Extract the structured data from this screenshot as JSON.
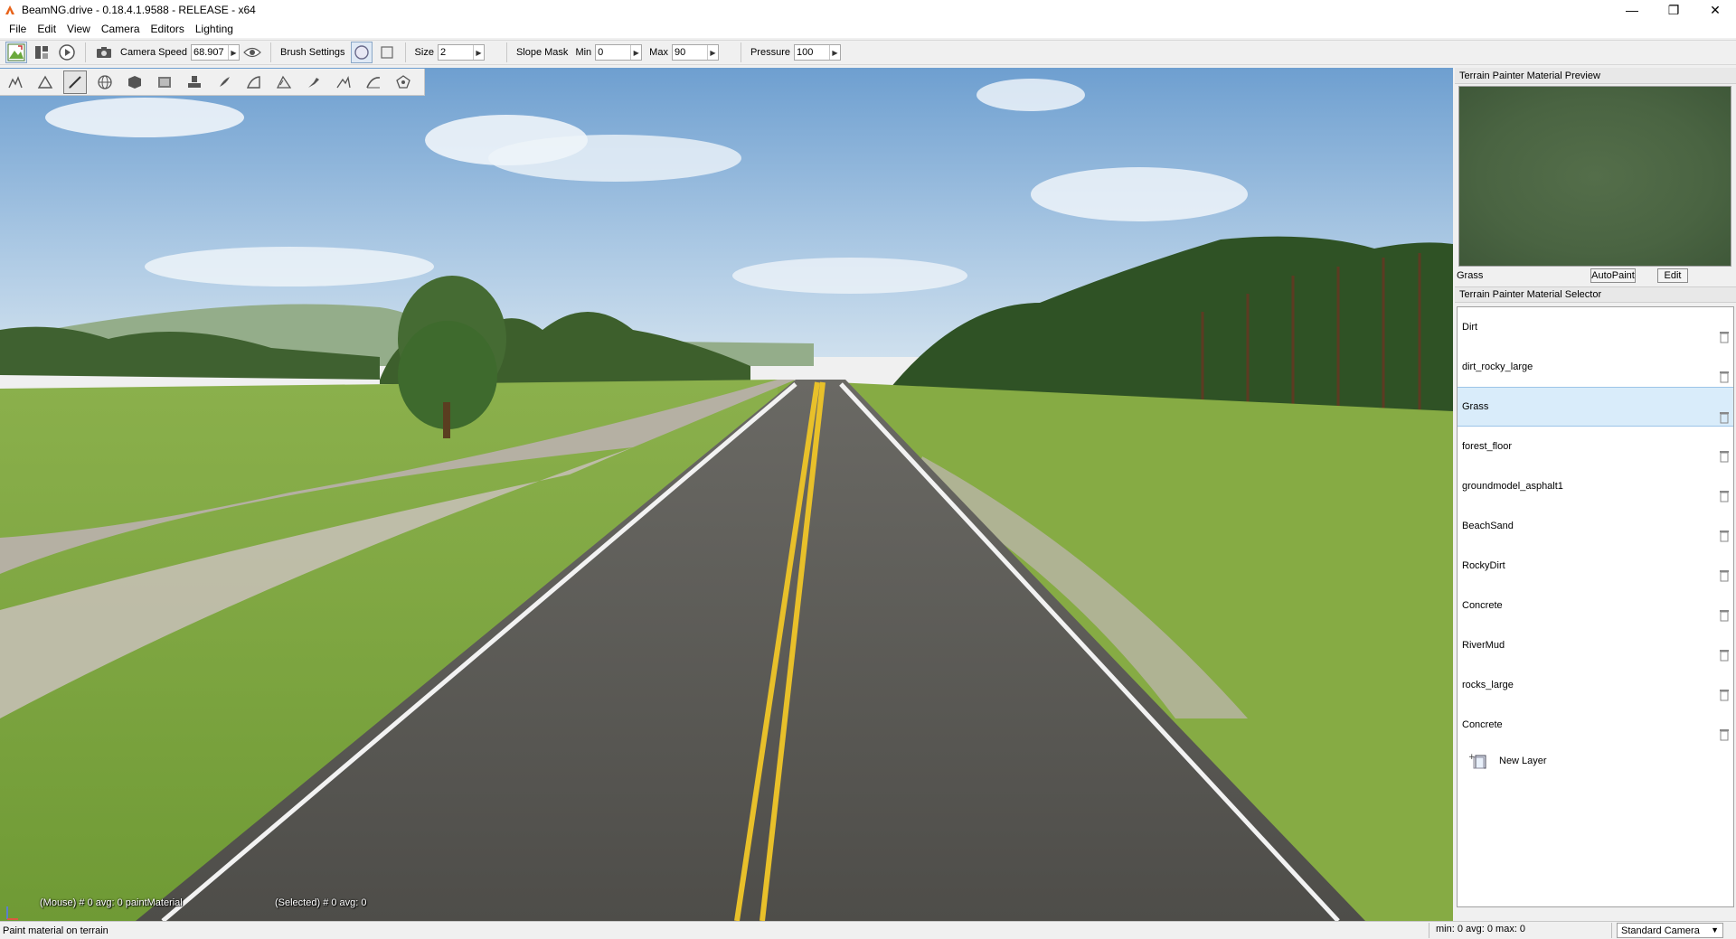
{
  "window": {
    "title": "BeamNG.drive - 0.18.4.1.9588 - RELEASE - x64",
    "minimize": "—",
    "maximize": "❐",
    "close": "✕"
  },
  "menu": [
    "File",
    "Edit",
    "View",
    "Camera",
    "Editors",
    "Lighting"
  ],
  "toolbar": {
    "camera_speed_label": "Camera Speed",
    "camera_speed_value": "68.907",
    "brush_settings_label": "Brush Settings",
    "size_label": "Size",
    "size_value": "2",
    "slope_mask_label": "Slope Mask",
    "min_label": "Min",
    "min_value": "0",
    "max_label": "Max",
    "max_value": "90",
    "pressure_label": "Pressure",
    "pressure_value": "100"
  },
  "tools": [
    "grab-elevation-icon",
    "raise-height-icon",
    "paint-material-icon",
    "globe-icon",
    "cube-icon",
    "heightmap-icon",
    "stamp-icon",
    "brush-icon",
    "slope-icon",
    "terrain-smooth-icon",
    "tool-11-icon",
    "tool-12-icon",
    "tool-13-icon",
    "tool-14-icon"
  ],
  "viewport": {
    "mouse_readout": "(Mouse) # 0  avg: 0 paintMaterial",
    "selected_readout": "(Selected) # 0  avg: 0"
  },
  "preview_panel": {
    "title": "Terrain Painter Material Preview",
    "material_name": "Grass",
    "autopaint_label": "AutoPaint",
    "edit_label": "Edit"
  },
  "selector_panel": {
    "title": "Terrain Painter Material Selector",
    "materials": [
      "Dirt",
      "dirt_rocky_large",
      "Grass",
      "forest_floor",
      "groundmodel_asphalt1",
      "BeachSand",
      "RockyDirt",
      "Concrete",
      "RiverMud",
      "rocks_large",
      "Concrete"
    ],
    "selected_index": 2,
    "new_layer_label": "New Layer"
  },
  "status": {
    "message": "Paint material on terrain",
    "stats": "min: 0  avg: 0  max: 0",
    "camera_mode": "Standard Camera"
  },
  "colors": {
    "selection": "#d9ecfa",
    "sky_top": "#6e9fd0",
    "grass": "#7fa642",
    "asphalt": "#54534f",
    "center_line": "#e8c02a"
  }
}
